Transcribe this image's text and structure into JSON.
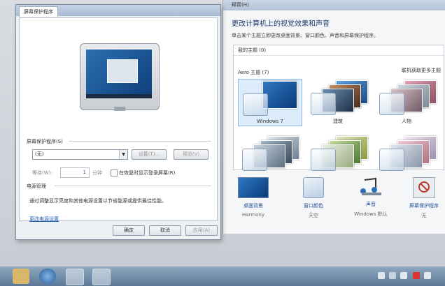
{
  "personalization": {
    "title_fragment": "释帮(H)",
    "heading": "更改计算机上的视觉效果和声音",
    "subheading": "单击某个主题立即更改桌面背景、窗口颜色、声音和屏幕保护程序。",
    "my_themes_label": "我的主题 (0)",
    "aero_label": "Aero 主题 (7)",
    "get_more_link": "联机获取更多主题",
    "themes": [
      {
        "name": "Windows 7"
      },
      {
        "name": "建筑"
      },
      {
        "name": "人物"
      },
      {
        "name": ""
      },
      {
        "name": ""
      },
      {
        "name": ""
      }
    ],
    "bottom": [
      {
        "label": "桌面背景",
        "value": "Harmony"
      },
      {
        "label": "窗口颜色",
        "value": "天空"
      },
      {
        "label": "声音",
        "value": "Windows 默认"
      },
      {
        "label": "屏幕保护程序",
        "value": "无"
      }
    ]
  },
  "dialog": {
    "tab_label": "屏幕保护程序",
    "group_screensaver": "屏幕保护程序(S)",
    "combo_value": "(无)",
    "settings_button": "设置(T)...",
    "preview_button": "预览(V)",
    "wait_label": "等待(W):",
    "wait_value": "1",
    "minutes_label": "分钟",
    "resume_checkbox": "在恢复时显示登录屏幕(R)",
    "group_power": "电源管理",
    "power_text": "通过调整显示亮度和其他电源设置以节省能源或提供最佳性能。",
    "power_link": "更改电源设置",
    "ok_button": "确定",
    "cancel_button": "取消",
    "apply_button": "应用(A)"
  },
  "colors": {
    "accent": "#1f5fb8",
    "selected_theme_bg": "#dcecfb",
    "taskbar": "#5b7897"
  }
}
